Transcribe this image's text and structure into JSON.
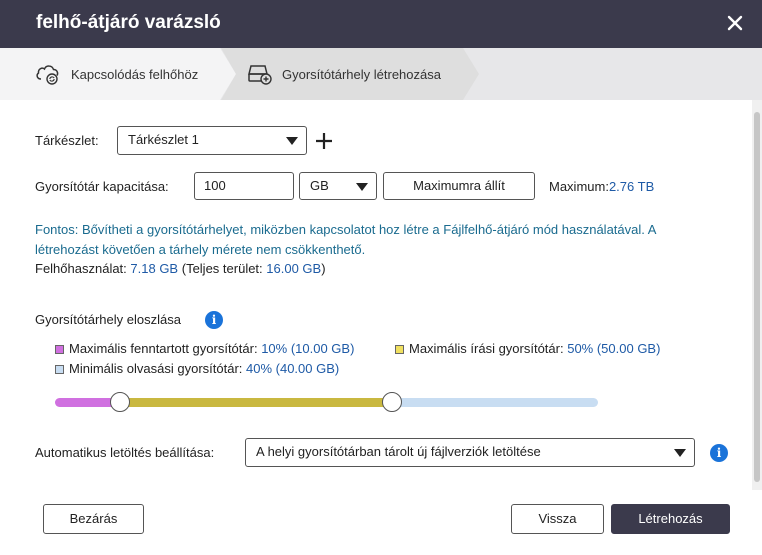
{
  "window": {
    "title": "felhő-átjáró varázsló"
  },
  "steps": [
    {
      "label": "Kapcsolódás felhőhöz"
    },
    {
      "label": "Gyorsítótárhely létrehozása"
    }
  ],
  "pool": {
    "label": "Tárkészlet:",
    "selected": "Tárkészlet 1"
  },
  "capacity": {
    "label": "Gyorsítótár kapacitása:",
    "value": "100",
    "unit": "GB",
    "max_button": "Maximumra állít",
    "max_label": "Maximum:",
    "max_value": "2.76 TB"
  },
  "notice": {
    "line1": "Fontos: Bővítheti a gyorsítótárhelyet, miközben kapcsolatot hoz létre a Fájlfelhő-átjáró mód használatával. A",
    "line2": "létrehozást követően a tárhely mérete nem csökkenthető."
  },
  "usage": {
    "label": "Felhőhasználat:",
    "used": "7.18 GB",
    "total_prefix": "(Teljes terület:",
    "total": "16.00 GB",
    "total_suffix": ")"
  },
  "distribution": {
    "title": "Gyorsítótárhely eloszlása",
    "reserved": {
      "label": "Maximális fenntartott gyorsítótár:",
      "value": "10% (10.00 GB)",
      "percent": 10,
      "color": "#d070e0"
    },
    "write": {
      "label": "Maximális írási gyorsítótár:",
      "value": "50% (50.00 GB)",
      "percent": 50,
      "color": "#c9b840"
    },
    "read": {
      "label": "Minimális olvasási gyorsítótár:",
      "value": "40% (40.00 GB)",
      "percent": 40,
      "color": "#c8ddf2"
    }
  },
  "autodownload": {
    "label": "Automatikus letöltés beállítása:",
    "selected": "A helyi gyorsítótárban tárolt új fájlverziók letöltése"
  },
  "buttons": {
    "close": "Bezárás",
    "back": "Vissza",
    "create": "Létrehozás"
  },
  "colors": {
    "titlebar": "#3b3a4c",
    "accent": "#1a73d9"
  }
}
